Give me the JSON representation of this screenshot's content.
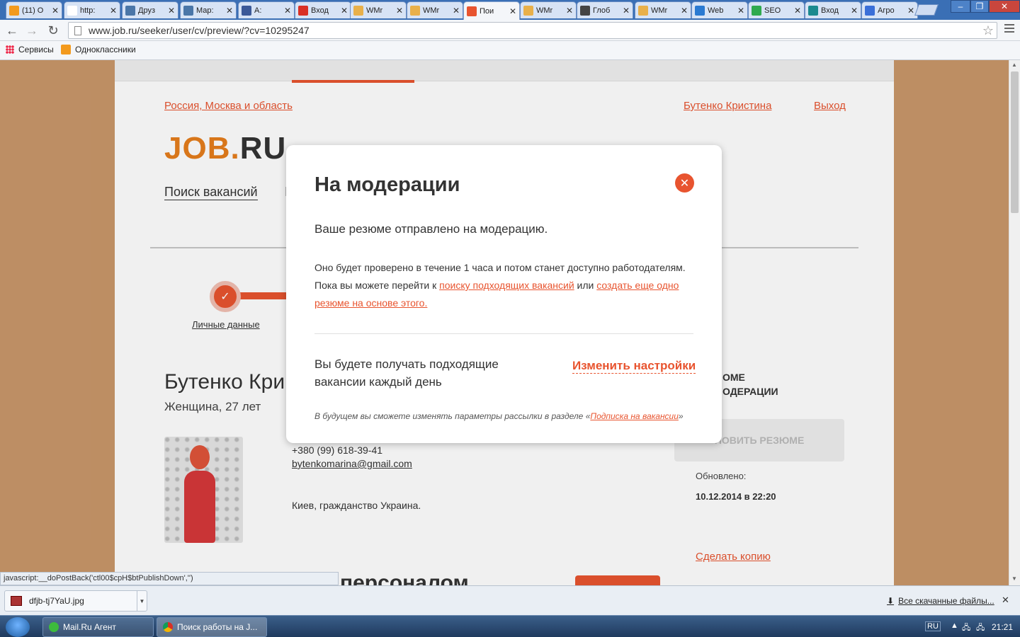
{
  "browser": {
    "tabs": [
      {
        "title": "(11) О",
        "icon": "ok-icon",
        "color": "#f39a1d"
      },
      {
        "title": "http:",
        "icon": "page-icon",
        "color": "#ffffff"
      },
      {
        "title": "Друз",
        "icon": "vk-icon",
        "color": "#4a76a8"
      },
      {
        "title": "Мар:",
        "icon": "vk-icon",
        "color": "#4a76a8"
      },
      {
        "title": "А:",
        "icon": "play-icon",
        "color": "#3b5998"
      },
      {
        "title": "Вход",
        "icon": "gmail-icon",
        "color": "#d93025"
      },
      {
        "title": "WMr",
        "icon": "wm-icon",
        "color": "#e8b04a"
      },
      {
        "title": "WMr",
        "icon": "wm-icon",
        "color": "#e8b04a"
      },
      {
        "title": "Пои",
        "icon": "jobru-icon",
        "color": "#e8542f"
      },
      {
        "title": "WMr",
        "icon": "wm-icon",
        "color": "#e8b04a"
      },
      {
        "title": "Глоб",
        "icon": "g-icon",
        "color": "#444444"
      },
      {
        "title": "WMr",
        "icon": "wm-icon",
        "color": "#e8b04a"
      },
      {
        "title": "Web",
        "icon": "globe-icon",
        "color": "#2a7ad2"
      },
      {
        "title": "SEO",
        "icon": "seo-icon",
        "color": "#2faa4f"
      },
      {
        "title": "Вход",
        "icon": "circle-icon",
        "color": "#1b8a8f"
      },
      {
        "title": "Агро",
        "icon": "g8-icon",
        "color": "#3a6fd8"
      }
    ],
    "url": "www.job.ru/seeker/user/cv/preview/?cv=10295247",
    "bookmarks": [
      {
        "label": "Сервисы"
      },
      {
        "label": "Одноклассники"
      }
    ]
  },
  "page": {
    "region": "Россия, Москва и область",
    "user_name": "Бутенко Кристина",
    "logout": "Выход",
    "logo_job": "JOB.",
    "logo_ru": "RU",
    "nav_search": "Поиск вакансий",
    "nav_second": "I",
    "step_label": "Личные данные",
    "person_name": "Бутенко Кри",
    "person_sub": "Женщина, 27 лет",
    "phone": "+380 (99) 618-39-41",
    "email": "bytenkomarina@gmail.com",
    "city": "Киев, гражданство Украина.",
    "side_status_1": "ОМЕ",
    "side_status_2": "ОДЕРАЦИИ",
    "refresh_button": "НОВИТЬ РЕЗЮМЕ",
    "updated_label": "Обновлено:",
    "updated_date": "10.12.2014 в 22:20",
    "copy_link": "Сделать копию",
    "section_title": "персоналом"
  },
  "modal": {
    "title": "На модерации",
    "lead": "Ваше резюме отправлено на модерацию.",
    "body_1": "Оно будет проверено в течение 1 часа и потом станет доступно работодателям. Пока вы можете перейти к ",
    "body_link_1": "поиску подходящих вакансий",
    "body_2": " или ",
    "body_link_2": "создать еще одно резюме на основе этого.",
    "sub": "Вы будете получать подходящие вакансии каждый день",
    "settings_link": "Изменить настройки",
    "note_1": "В будущем вы сможете изменять параметры рассылки в разделе «",
    "note_link": "Подписка на вакансии",
    "note_2": "»"
  },
  "status_url": "javascript:__doPostBack('ctl00$cpH$btPublishDown','')",
  "downloads": {
    "file": "dfjb-tj7YaU.jpg",
    "all_link": "Все скачанные файлы..."
  },
  "taskbar": {
    "tasks": [
      {
        "label": "Mail.Ru Агент"
      },
      {
        "label": "Поиск работы на J..."
      }
    ],
    "lang": "RU",
    "clock": "21:21"
  },
  "colors": {
    "accent": "#e8542f",
    "page_bg": "#c9976a"
  }
}
